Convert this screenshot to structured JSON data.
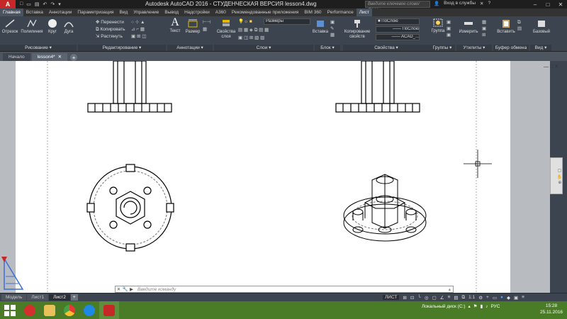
{
  "titlebar": {
    "title": "Autodesk AutoCAD 2016 - СТУДЕНЧЕСКАЯ ВЕРСИЯ     lesson4.dwg",
    "search_placeholder": "Введите ключевое слово/фразу",
    "signin": "Вход в службы",
    "qat": [
      "□",
      "▭",
      "▤",
      "↶",
      "↷",
      "▾"
    ]
  },
  "ribbon_tabs": [
    "Главная",
    "Вставка",
    "Аннотации",
    "Параметризация",
    "Вид",
    "Управление",
    "Вывод",
    "Надстройки",
    "A360",
    "Рекомендованные приложения",
    "BIM 360",
    "Performance",
    "Лист"
  ],
  "ribbon": {
    "draw": {
      "line": "Отрезок",
      "polyline": "Полилиния",
      "circle": "Круг",
      "arc": "Дуга",
      "panel": "Рисование ▾"
    },
    "modify": {
      "move": "Перенести",
      "copy": "Копировать",
      "stretch": "Растянуть",
      "panel": "Редактирование ▾"
    },
    "annotation": {
      "text": "Текст",
      "dimension": "Размер",
      "panel": "Аннотации ▾"
    },
    "layers": {
      "properties": "Свойства слоя",
      "layer_combo": "Размеры",
      "panel": "Слои ▾"
    },
    "block": {
      "insert": "Вставка",
      "panel": "Блок ▾"
    },
    "properties": {
      "match": "Копирование свойств",
      "color": "ПоСлою",
      "linetype": "ПоСлою",
      "lineweight": "ACAD_...",
      "panel": "Свойства ▾"
    },
    "groups": {
      "group": "Группа",
      "panel": "Группы ▾"
    },
    "utilities": {
      "measure": "Измерить",
      "panel": "Утилиты ▾"
    },
    "clipboard": {
      "paste": "Вставить",
      "panel": "Буфер обмена"
    },
    "view": {
      "base": "Базовый",
      "panel": "Вид ▾"
    }
  },
  "doc_tabs": [
    {
      "label": "Начало"
    },
    {
      "label": "lesson4*"
    }
  ],
  "command": {
    "placeholder": "Введите команду"
  },
  "layout_tabs": [
    "Модель",
    "Лист1",
    "Лист2"
  ],
  "status": {
    "mode": "ЛИСТ"
  },
  "tray": {
    "disk": "Локальный диск (C:)",
    "lang": "РУС",
    "time": "15:28",
    "date": "25.11.2016"
  },
  "colors": {
    "accent": "#c62828",
    "ribbon": "#3c4450",
    "taskbar": "#4a7b26"
  }
}
